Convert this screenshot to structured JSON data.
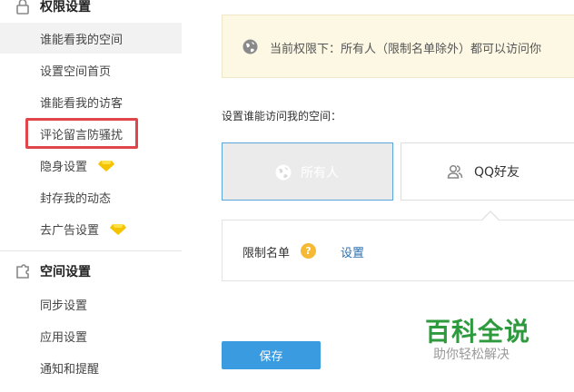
{
  "sidebar": {
    "section1": {
      "title": "权限设置",
      "icon": "lock-icon"
    },
    "items1": [
      {
        "label": "谁能看我的空间",
        "active": true
      },
      {
        "label": "设置空间首页"
      },
      {
        "label": "谁能看我的访客"
      },
      {
        "label": "评论留言防骚扰",
        "highlighted": true
      },
      {
        "label": "隐身设置",
        "badge": "diamond-icon"
      },
      {
        "label": "封存我的动态"
      },
      {
        "label": "去广告设置",
        "badge": "diamond-icon"
      }
    ],
    "section2": {
      "title": "空间设置",
      "icon": "puzzle-icon"
    },
    "items2": [
      {
        "label": "同步设置"
      },
      {
        "label": "应用设置"
      },
      {
        "label": "通知和提醒"
      }
    ]
  },
  "main": {
    "notice": {
      "text": "当前权限下：所有人（限制名单除外）都可以访问你",
      "icon": "globe-icon"
    },
    "question_label": "设置谁能访问我的空间：",
    "options": [
      {
        "label": "所有人",
        "icon": "globe-icon",
        "selected": true
      },
      {
        "label": "QQ好友",
        "icon": "friends-icon",
        "selected": false
      }
    ],
    "restrict": {
      "label": "限制名单",
      "help": "?",
      "settings_link": "设置"
    },
    "save_label": "保存"
  },
  "watermark": {
    "big": "百科全说",
    "small": "助你轻松解决"
  },
  "colors": {
    "accent": "#3a9be0",
    "highlight": "#e0454a",
    "notice_bg": "#fdf8e4",
    "badge": "#f5b935",
    "watermark": "#2e9a3e"
  }
}
